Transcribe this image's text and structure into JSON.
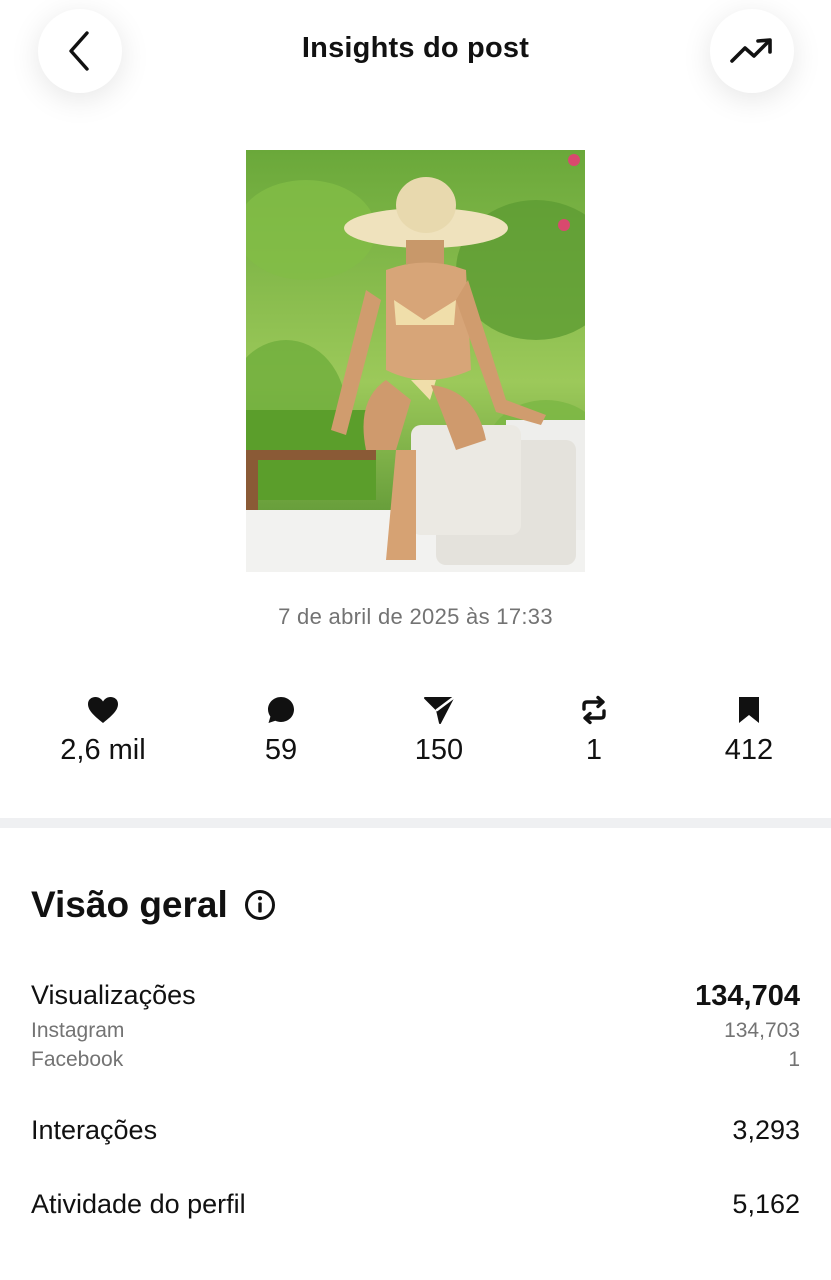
{
  "header": {
    "title": "Insights do post",
    "back_icon": "chevron-left-icon",
    "trend_icon": "trending-up-icon"
  },
  "post": {
    "date": "7 de abril de 2025 às 17:33"
  },
  "stats": [
    {
      "icon": "heart-icon",
      "value": "2,6 mil"
    },
    {
      "icon": "comment-icon",
      "value": "59"
    },
    {
      "icon": "send-icon",
      "value": "150"
    },
    {
      "icon": "repost-icon",
      "value": "1"
    },
    {
      "icon": "bookmark-icon",
      "value": "412"
    }
  ],
  "overview": {
    "title": "Visão geral",
    "views": {
      "label": "Visualizações",
      "value": "134,704",
      "breakdown": [
        {
          "label": "Instagram",
          "value": "134,703"
        },
        {
          "label": "Facebook",
          "value": "1"
        }
      ]
    },
    "interactions": {
      "label": "Interações",
      "value": "3,293"
    },
    "profile_activity": {
      "label": "Atividade do perfil",
      "value": "5,162"
    }
  },
  "colors": {
    "text": "#111111",
    "muted": "#737373",
    "divider": "#eff0f2"
  }
}
